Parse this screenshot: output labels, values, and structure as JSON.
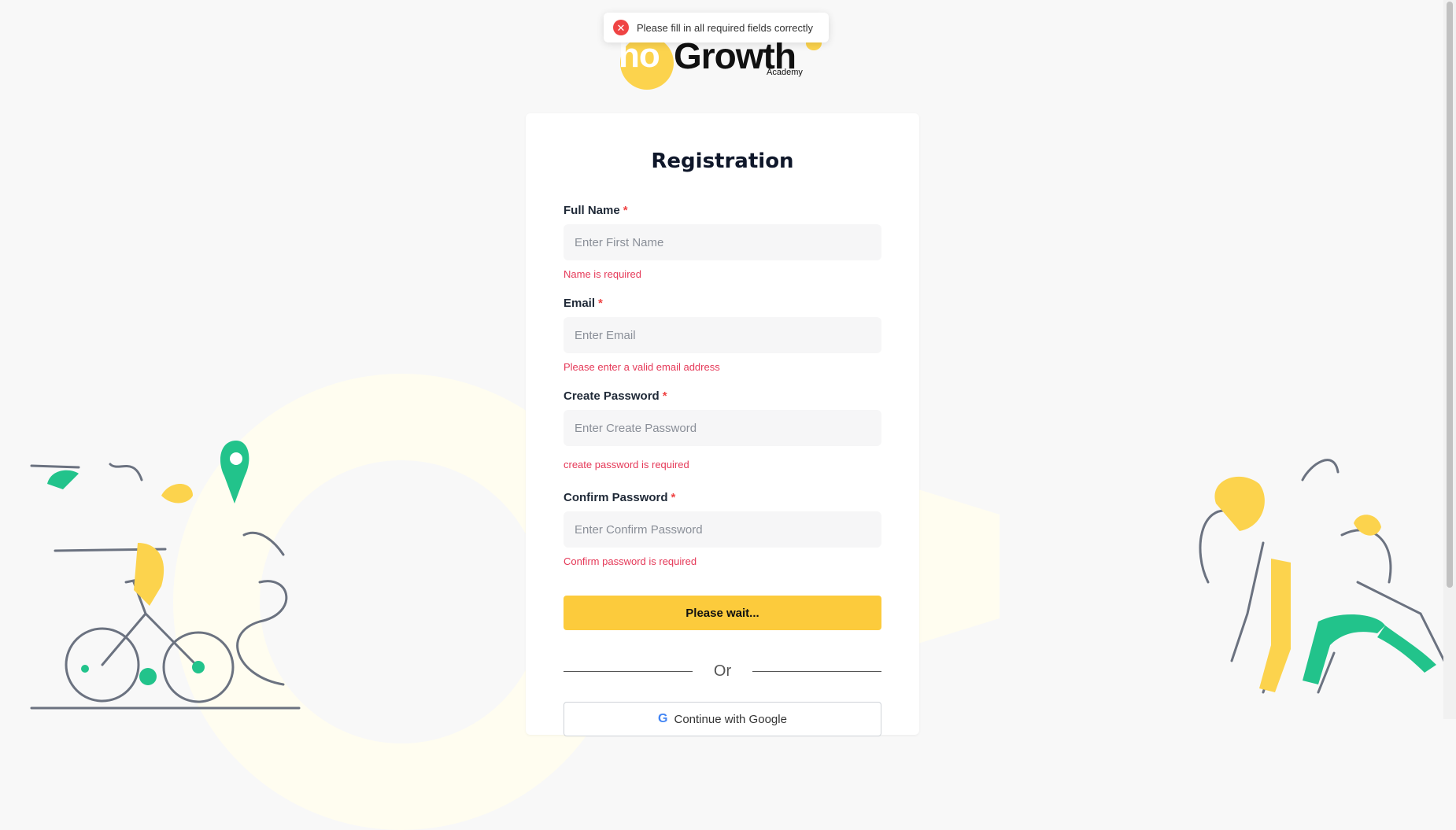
{
  "toast": {
    "message": "Please fill in all required fields correctly",
    "icon": "error-icon"
  },
  "logo": {
    "prefix": "ho",
    "name": "Growth",
    "subtitle": "Academy"
  },
  "form": {
    "title": "Registration",
    "required_marker": "*",
    "fields": [
      {
        "label": "Full Name",
        "placeholder": "Enter First Name",
        "value": "",
        "error": "Name is required"
      },
      {
        "label": "Email",
        "placeholder": "Enter Email",
        "value": "",
        "error": "Please enter a valid email address"
      },
      {
        "label": "Create Password",
        "placeholder": "Enter Create Password",
        "value": "",
        "error": "create password is required"
      },
      {
        "label": "Confirm Password",
        "placeholder": "Enter Confirm Password",
        "value": "",
        "error": "Confirm password is required"
      }
    ],
    "submit_label": "Please wait...",
    "divider_text": "Or",
    "google_label": "Continue with Google"
  },
  "colors": {
    "accent": "#fccb3c",
    "error": "#e53958",
    "background": "#f8f8f8",
    "illustration_green": "#22c38b"
  }
}
